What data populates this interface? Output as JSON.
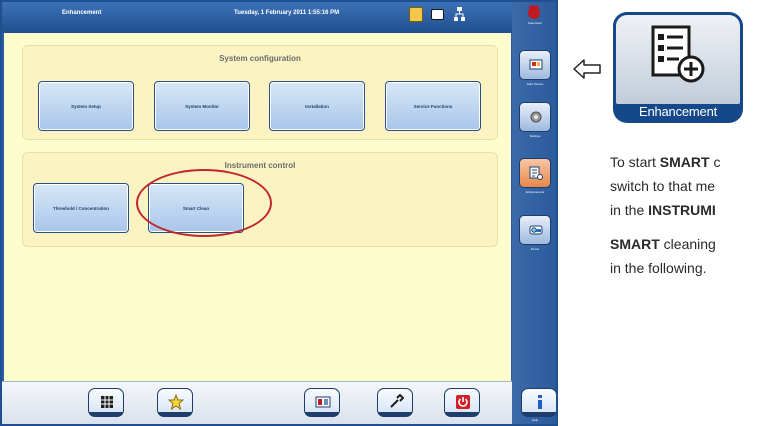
{
  "screen": {
    "title": "Enhancement",
    "datetime": "Tuesday, 1 February 2011 1:55:16 PM"
  },
  "system_configuration": {
    "title": "System configuration",
    "buttons": [
      "System Setup",
      "System Monitor",
      "Installation",
      "Service Functions"
    ]
  },
  "instrument_control": {
    "title": "Instrument control",
    "buttons": [
      "Threshold / Concentration",
      "Smart Clean"
    ]
  },
  "sidebar": [
    "Supervisor",
    "Start Screen",
    "Settings",
    "Enhancement",
    "Errors",
    "Help"
  ],
  "bottom_toolbar": {
    "icons": [
      "grid-icon",
      "star-icon",
      "remote-service-icon",
      "wrench-icon",
      "power-icon",
      "info-icon"
    ]
  },
  "doc": {
    "tile_label": "Enhancement",
    "p1_line1_a": "To start ",
    "p1_line1_b": "SMART",
    "p1_line1_c": " c",
    "p1_line2": "switch to that me",
    "p1_line3_a": "in the ",
    "p1_line3_b": "INSTRUMI",
    "p2_line1_a": "SMART",
    "p2_line1_b": " cleaning",
    "p2_line2": "in the following."
  },
  "colors": {
    "panel_background": "#fdfccd",
    "frame_blue": "#1f4f8e",
    "highlight_ring": "#c1272d",
    "active_sidebar": "#e8884a"
  }
}
